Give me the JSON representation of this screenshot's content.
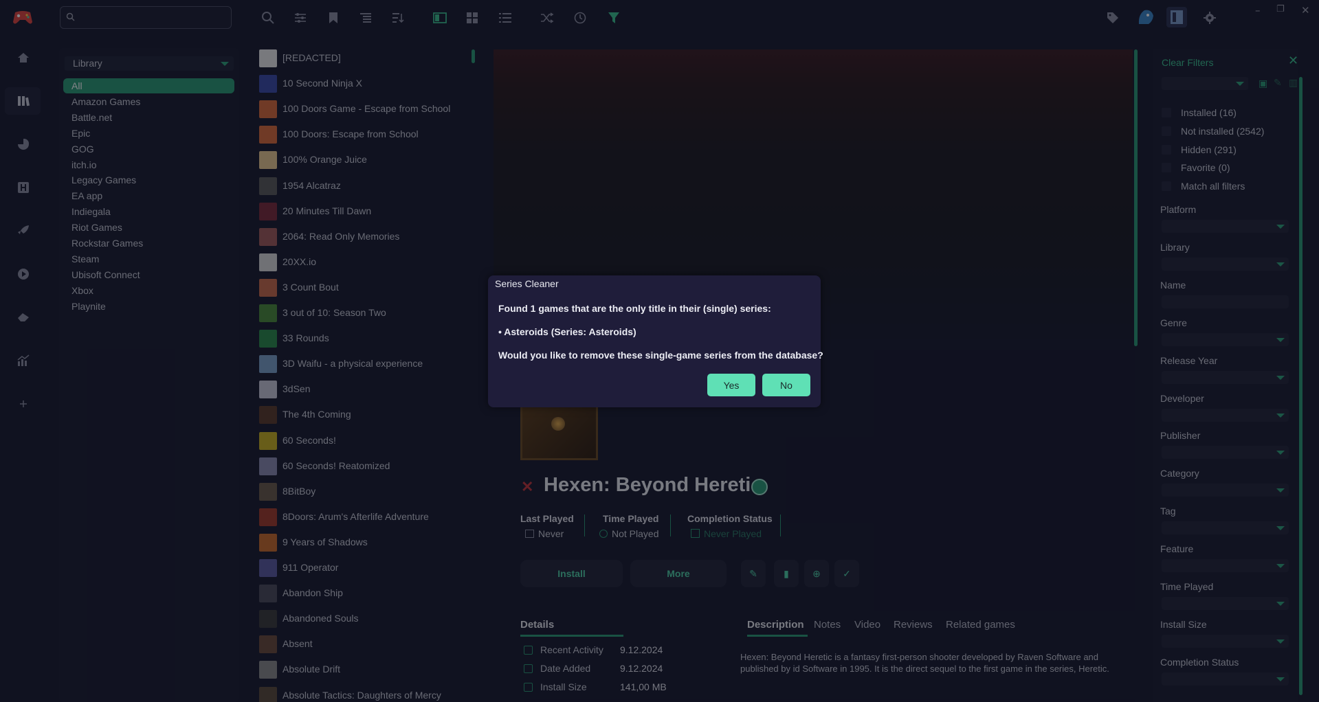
{
  "search": {
    "placeholder": ""
  },
  "library": {
    "selector": "Library",
    "items": [
      "All",
      "Amazon Games",
      "Battle.net",
      "Epic",
      "GOG",
      "itch.io",
      "Legacy Games",
      "EA app",
      "Indiegala",
      "Riot Games",
      "Rockstar Games",
      "Steam",
      "Ubisoft Connect",
      "Xbox",
      "Playnite"
    ],
    "selected": 0
  },
  "games": [
    "[REDACTED]",
    "10 Second Ninja X",
    "100 Doors Game - Escape from School",
    "100 Doors: Escape from School",
    "100% Orange Juice",
    "1954 Alcatraz",
    "20 Minutes Till Dawn",
    "2064: Read Only Memories",
    "20XX.io",
    "3 Count Bout",
    "3 out of 10: Season Two",
    "33 Rounds",
    "3D Waifu - a physical experience",
    "3dSen",
    "The 4th Coming",
    "60 Seconds!",
    "60 Seconds! Reatomized",
    "8BitBoy",
    "8Doors: Arum's Afterlife Adventure",
    "9 Years of Shadows",
    "911 Operator",
    "Abandon Ship",
    "Abandoned Souls",
    "Absent",
    "Absolute Drift",
    "Absolute Tactics: Daughters of Mercy"
  ],
  "game": {
    "title": "Hexen: Beyond Heretic",
    "stats": [
      {
        "label": "Last Played",
        "value": "Never"
      },
      {
        "label": "Time Played",
        "value": "Not Played"
      },
      {
        "label": "Completion Status",
        "value": "Never Played"
      }
    ],
    "buttons": {
      "install": "Install",
      "more": "More"
    },
    "details_heading": "Details",
    "tabs": [
      "Description",
      "Notes",
      "Video",
      "Reviews",
      "Related games"
    ],
    "details": [
      {
        "label": "Recent Activity",
        "value": "9.12.2024"
      },
      {
        "label": "Date Added",
        "value": "9.12.2024"
      },
      {
        "label": "Install Size",
        "value": "141,00 MB"
      }
    ],
    "description": "Hexen: Beyond Heretic is a fantasy first-person shooter developed by Raven Software and published by id Software in 1995. It is the direct sequel to the first game in the series, Heretic."
  },
  "filters": {
    "clear": "Clear Filters",
    "checks": [
      "Installed (16)",
      "Not installed (2542)",
      "Hidden (291)",
      "Favorite (0)",
      "Match all filters"
    ],
    "fields": [
      "Platform",
      "Library",
      "Name",
      "Genre",
      "Release Year",
      "Developer",
      "Publisher",
      "Category",
      "Tag",
      "Feature",
      "Time Played",
      "Install Size",
      "Completion Status"
    ]
  },
  "dialog": {
    "title": "Series Cleaner",
    "line1": "Found 1 games that are the only title in their (single) series:",
    "line2": "• Asteroids (Series: Asteroids)",
    "line3": "Would you like to remove these single-game series from the database?",
    "yes": "Yes",
    "no": "No"
  },
  "colors": {
    "accent": "#2a9a74",
    "accent_light": "#5fe0b5",
    "background": "#181a2e",
    "panel": "#1a1c31"
  }
}
